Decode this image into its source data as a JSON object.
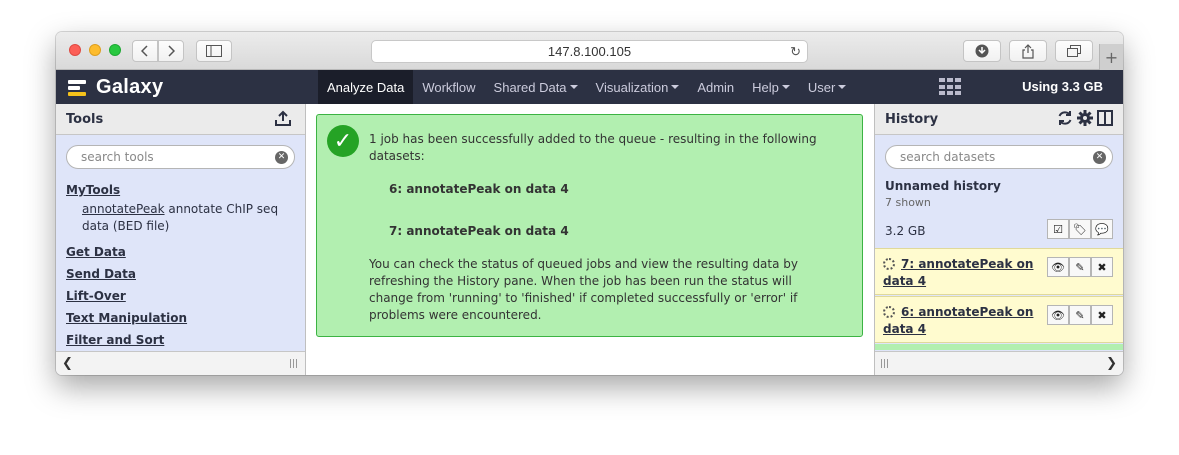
{
  "browser": {
    "url": "147.8.100.105"
  },
  "masthead": {
    "brand": "Galaxy",
    "nav": [
      {
        "label": "Analyze Data",
        "active": true,
        "dropdown": false
      },
      {
        "label": "Workflow",
        "active": false,
        "dropdown": false
      },
      {
        "label": "Shared Data",
        "active": false,
        "dropdown": true
      },
      {
        "label": "Visualization",
        "active": false,
        "dropdown": true
      },
      {
        "label": "Admin",
        "active": false,
        "dropdown": false
      },
      {
        "label": "Help",
        "active": false,
        "dropdown": true
      },
      {
        "label": "User",
        "active": false,
        "dropdown": true
      }
    ],
    "usage": "Using 3.3 GB"
  },
  "tools": {
    "title": "Tools",
    "search_placeholder": "search tools",
    "sections": {
      "mytools": "MyTools",
      "get_data": "Get Data",
      "send_data": "Send Data",
      "lift_over": "Lift-Over",
      "text_manipulation": "Text Manipulation",
      "filter_sort": "Filter and Sort"
    },
    "mytools_entry": {
      "link": "annotatePeak",
      "description": " annotate ChIP seq data (BED file)"
    }
  },
  "center": {
    "message_intro": "1 job has been successfully added to the queue - resulting in the following datasets:",
    "datasets": [
      "6: annotatePeak on data 4",
      "7: annotatePeak on data 4"
    ],
    "message_body": "You can check the status of queued jobs and view the resulting data by refreshing the History pane. When the job has been run the status will change from 'running' to 'finished' if completed successfully or 'error' if problems were encountered."
  },
  "history": {
    "title": "History",
    "search_placeholder": "search datasets",
    "name": "Unnamed history",
    "shown": "7 shown",
    "size": "3.2 GB",
    "items": [
      {
        "title": "7: annotatePeak on data 4",
        "state": "running"
      },
      {
        "title": "6: annotatePeak on data 4",
        "state": "running"
      }
    ]
  }
}
